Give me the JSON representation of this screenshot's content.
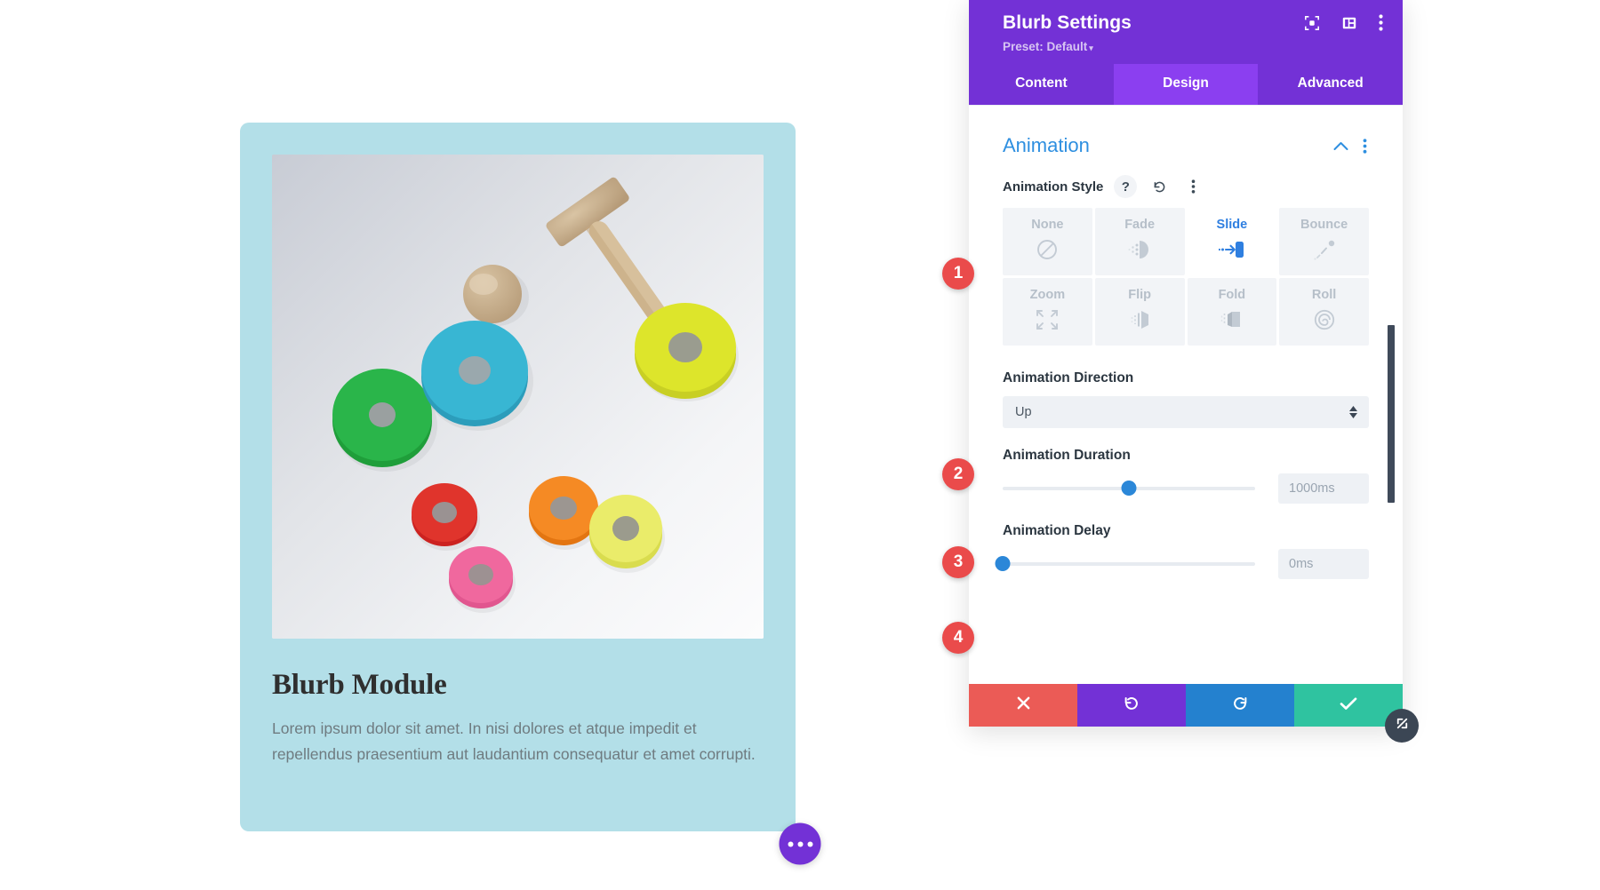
{
  "canvas": {
    "blurb": {
      "title": "Blurb Module",
      "body": "Lorem ipsum dolor sit amet. In nisi dolores et atque impedit et repellendus praesentium aut laudantium consequatur et amet corrupti.",
      "card_bg": "#b3dfe8",
      "image_alt": "wooden-stacking-toy-rings-photo"
    },
    "fab": {
      "name": "page-settings-fab",
      "color": "#7331d6"
    }
  },
  "panel": {
    "title": "Blurb Settings",
    "preset_label": "Preset: Default",
    "preset_caret": "▾",
    "brand_purple": "#7331d6",
    "header_icons": [
      {
        "name": "focus-target-icon"
      },
      {
        "name": "layout-columns-icon"
      },
      {
        "name": "kebab-menu-icon"
      }
    ],
    "tabs": [
      {
        "label": "Content",
        "active": false
      },
      {
        "label": "Design",
        "active": true
      },
      {
        "label": "Advanced",
        "active": false
      }
    ],
    "section": {
      "title": "Animation",
      "collapsed": false,
      "accent": "#2e8fe0"
    },
    "animation_style": {
      "label": "Animation Style",
      "help_glyph": "?",
      "selected": "Slide",
      "options": [
        {
          "label": "None",
          "icon": "no-entry-icon",
          "selected": false
        },
        {
          "label": "Fade",
          "icon": "fade-dots-icon",
          "selected": false
        },
        {
          "label": "Slide",
          "icon": "slide-arrow-icon",
          "selected": true
        },
        {
          "label": "Bounce",
          "icon": "bounce-trail-icon",
          "selected": false
        },
        {
          "label": "Zoom",
          "icon": "zoom-expand-icon",
          "selected": false
        },
        {
          "label": "Flip",
          "icon": "flip-panel-icon",
          "selected": false
        },
        {
          "label": "Fold",
          "icon": "fold-page-icon",
          "selected": false
        },
        {
          "label": "Roll",
          "icon": "roll-spiral-icon",
          "selected": false
        }
      ]
    },
    "animation_direction": {
      "label": "Animation Direction",
      "value": "Up"
    },
    "animation_duration": {
      "label": "Animation Duration",
      "value": "1000ms",
      "slider_percent": 50
    },
    "animation_delay": {
      "label": "Animation Delay",
      "value": "0ms",
      "slider_percent": 0
    },
    "callouts": [
      {
        "number": "1"
      },
      {
        "number": "2"
      },
      {
        "number": "3"
      },
      {
        "number": "4"
      }
    ],
    "actions": [
      {
        "name": "cancel-button",
        "icon": "x-icon",
        "color": "#eb5b56"
      },
      {
        "name": "undo-button",
        "icon": "undo-icon",
        "color": "#7331d6"
      },
      {
        "name": "redo-button",
        "icon": "redo-icon",
        "color": "#2481cf"
      },
      {
        "name": "save-button",
        "icon": "checkmark-icon",
        "color": "#2fc3a0"
      }
    ],
    "resize_handle": {
      "name": "resize-handle",
      "icon": "diagonal-arrows-icon"
    }
  }
}
